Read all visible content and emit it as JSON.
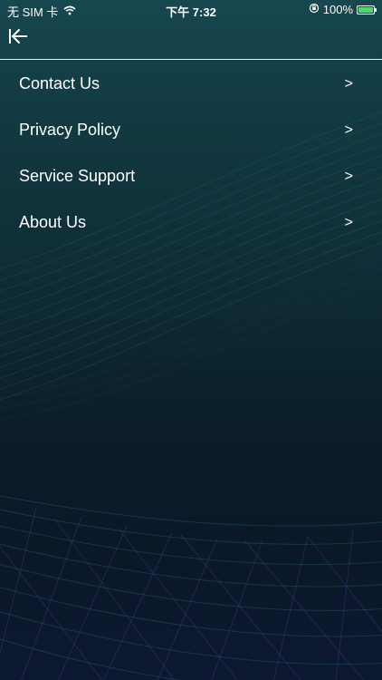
{
  "status_bar": {
    "carrier": "无 SIM 卡",
    "time": "下午 7:32",
    "battery_percent": "100%",
    "wifi_icon": "wifi-icon",
    "rotation_lock_icon": "rotation-lock-icon",
    "battery_icon": "battery-charging-icon"
  },
  "nav": {
    "back_icon": "back-arrow-icon"
  },
  "menu": {
    "items": [
      {
        "label": "Contact Us",
        "arrow": ">"
      },
      {
        "label": "Privacy Policy",
        "arrow": ">"
      },
      {
        "label": "Service Support",
        "arrow": ">"
      },
      {
        "label": "About Us",
        "arrow": ">"
      }
    ]
  },
  "colors": {
    "background_top": "#17474f",
    "background_bottom": "#0c1830",
    "text": "#ffffff",
    "battery_fill": "#4cd964"
  }
}
